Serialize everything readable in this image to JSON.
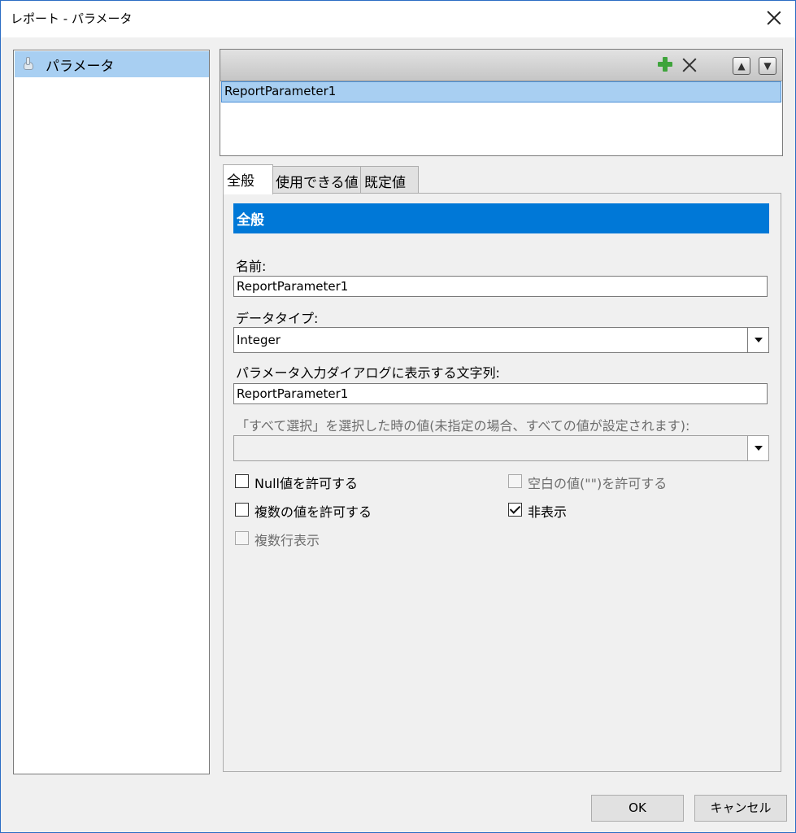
{
  "window": {
    "title": "レポート - パラメータ"
  },
  "sidebar": {
    "items": [
      {
        "label": "パラメータ",
        "icon": "hand-icon"
      }
    ]
  },
  "parameter_list": {
    "toolbar": {
      "add_icon": "plus-icon",
      "delete_icon": "x-icon",
      "up_icon": "arrow-up-icon",
      "down_icon": "arrow-down-icon"
    },
    "items": [
      "ReportParameter1"
    ]
  },
  "tabs": [
    {
      "label": "全般",
      "active": true
    },
    {
      "label": "使用できる値",
      "active": false
    },
    {
      "label": "既定値",
      "active": false
    }
  ],
  "general": {
    "section_title": "全般",
    "name_label": "名前:",
    "name_value": "ReportParameter1",
    "datatype_label": "データタイプ:",
    "datatype_value": "Integer",
    "prompt_label": "パラメータ入力ダイアログに表示する文字列:",
    "prompt_value": "ReportParameter1",
    "selectall_label": "「すべて選択」を選択した時の値(未指定の場合、すべての値が設定されます):",
    "selectall_value": ""
  },
  "options": {
    "allow_null": {
      "label": "Null値を許可する",
      "checked": false,
      "enabled": true
    },
    "allow_blank": {
      "label": "空白の値(\"\")を許可する",
      "checked": false,
      "enabled": false
    },
    "allow_multi": {
      "label": "複数の値を許可する",
      "checked": false,
      "enabled": true
    },
    "hidden": {
      "label": "非表示",
      "checked": true,
      "enabled": true
    },
    "multiline": {
      "label": "複数行表示",
      "checked": false,
      "enabled": false
    }
  },
  "buttons": {
    "ok": "OK",
    "cancel": "キャンセル"
  },
  "colors": {
    "accent": "#0078d7",
    "selection": "#a8cff2"
  }
}
